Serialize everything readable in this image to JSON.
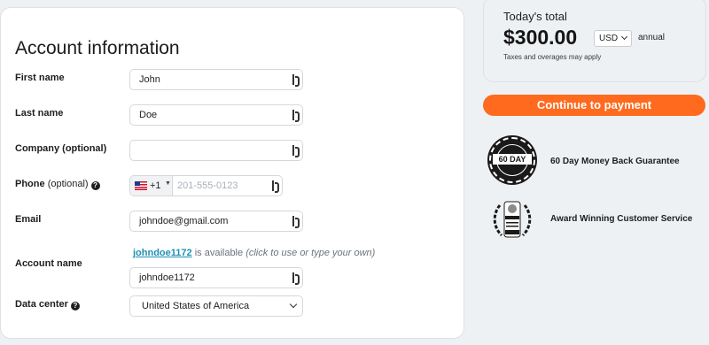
{
  "form": {
    "title": "Account information",
    "first_name": {
      "label": "First name",
      "value": "John"
    },
    "last_name": {
      "label": "Last name",
      "value": "Doe"
    },
    "company": {
      "label": "Company (optional)",
      "value": ""
    },
    "phone": {
      "label": "Phone",
      "label_suffix": "(optional)",
      "dial_code": "+1",
      "placeholder": "201-555-0123",
      "value": ""
    },
    "email": {
      "label": "Email",
      "value": "johndoe@gmail.com"
    },
    "account_name": {
      "label": "Account name",
      "suggested": "johndoe1172",
      "available_text": "is available",
      "hint_text": "(click to use or type your own)",
      "value": "johndoe1172"
    },
    "data_center": {
      "label": "Data center",
      "value": "United States of America"
    }
  },
  "summary": {
    "label": "Today's total",
    "amount": "$300.00",
    "currency": "USD",
    "period": "annual",
    "note": "Taxes and overages may apply"
  },
  "pay_button": {
    "label": "Continue to payment",
    "color": "#ff6a1e"
  },
  "guarantees": [
    {
      "icon": "60-day-seal-icon",
      "badge_text": "60 DAY",
      "text": "60 Day Money Back Guarantee"
    },
    {
      "icon": "award-laurel-icon",
      "text": "Award Winning Customer Service"
    }
  ],
  "colors": {
    "accent": "#ff6a1e",
    "link": "#1e90b5",
    "background": "#eef1f4"
  }
}
